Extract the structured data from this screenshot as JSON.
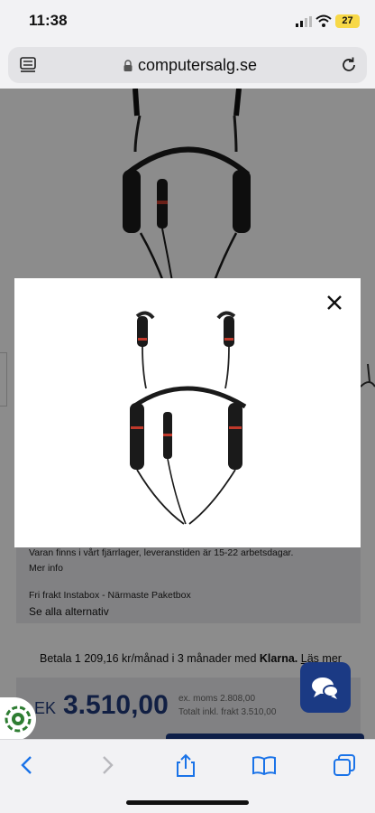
{
  "status": {
    "time": "11:38",
    "battery": "27",
    "colors": {
      "battery": "#f7d847"
    }
  },
  "browser": {
    "url": "computersalg.se",
    "icons": [
      "reader-mode-icon",
      "lock-icon",
      "reload-icon"
    ]
  },
  "page": {
    "stock_text": "Varan finns i vårt fjärrlager, leveranstiden är 15-22 arbetsdagar.",
    "more_info": "Mer info",
    "shipping": "Fri frakt Instabox - Närmaste Paketbox",
    "see_all": "Se alla alternativ",
    "klarna_pre": "Betala 1 209,16 kr/månad i 3 månader med ",
    "klarna_brand": "Klarna.",
    "klarna_link": "Läs mer",
    "currency": "EK",
    "price": "3.510,00",
    "ex_moms": "ex. moms 2.808,00",
    "inkl_frakt": "Totalt inkl. frakt 3.510,00",
    "colors": {
      "brand": "#1b3a84",
      "price": "#1f3a7a"
    }
  },
  "modal": {
    "image": "neckband-headset-image",
    "close_icon": "close-icon"
  },
  "toolbar": {
    "icons": [
      "back-icon",
      "forward-icon",
      "share-icon",
      "bookmarks-icon",
      "tabs-icon"
    ]
  }
}
